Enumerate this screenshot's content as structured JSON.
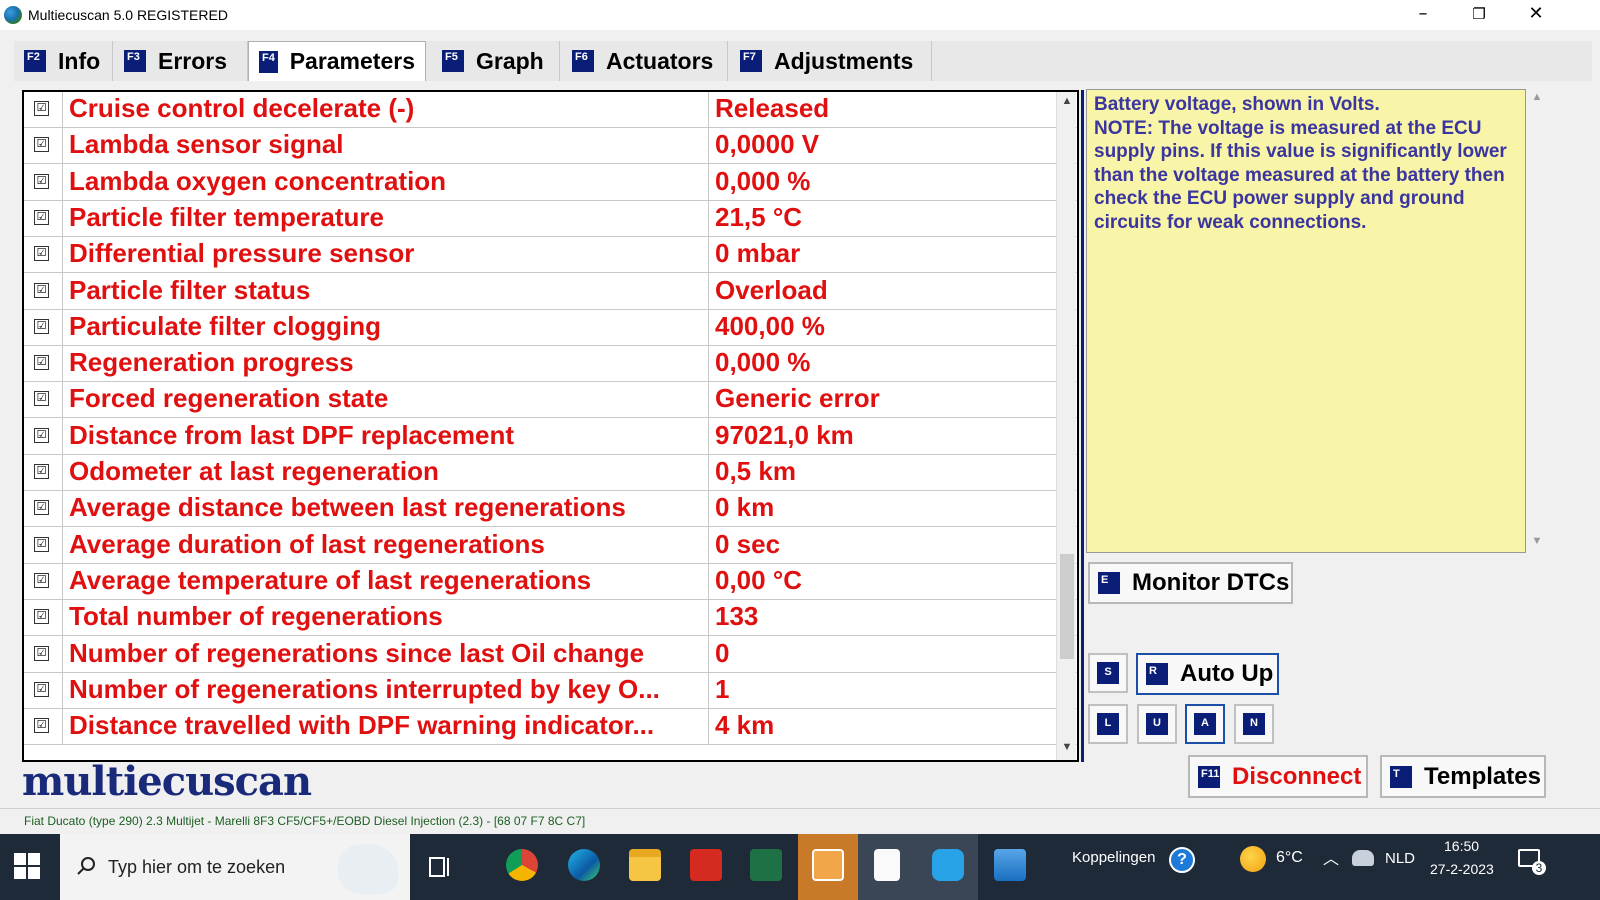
{
  "window": {
    "title": "Multiecuscan 5.0 REGISTERED",
    "minimize": "–",
    "maximize": "❐",
    "close": "✕"
  },
  "tabs": [
    {
      "key": "F2",
      "label": "Info"
    },
    {
      "key": "F3",
      "label": "Errors"
    },
    {
      "key": "F4",
      "label": "Parameters",
      "active": true
    },
    {
      "key": "F5",
      "label": "Graph"
    },
    {
      "key": "F6",
      "label": "Actuators"
    },
    {
      "key": "F7",
      "label": "Adjustments"
    }
  ],
  "parameters": [
    {
      "name": "Cruise control decelerate (-)",
      "value": "Released"
    },
    {
      "name": "Lambda sensor signal",
      "value": "0,0000 V"
    },
    {
      "name": "Lambda oxygen concentration",
      "value": "0,000 %"
    },
    {
      "name": "Particle filter temperature",
      "value": "21,5 °C"
    },
    {
      "name": "Differential pressure sensor",
      "value": "0 mbar"
    },
    {
      "name": "Particle filter status",
      "value": "Overload"
    },
    {
      "name": "Particulate filter clogging",
      "value": "400,00 %"
    },
    {
      "name": "Regeneration progress",
      "value": "0,000 %"
    },
    {
      "name": "Forced regeneration state",
      "value": "Generic error"
    },
    {
      "name": "Distance from last DPF replacement",
      "value": "97021,0 km"
    },
    {
      "name": "Odometer at last regeneration",
      "value": "0,5 km"
    },
    {
      "name": "Average distance between last regenerations",
      "value": "0 km"
    },
    {
      "name": "Average duration of last regenerations",
      "value": "0 sec"
    },
    {
      "name": "Average temperature of last regenerations",
      "value": "0,00 °C"
    },
    {
      "name": "Total number of regenerations",
      "value": "133"
    },
    {
      "name": "Number of regenerations since last Oil change",
      "value": "0"
    },
    {
      "name": "Number of regenerations interrupted by key O...",
      "value": "1"
    },
    {
      "name": "Distance travelled with DPF warning indicator...",
      "value": "4 km"
    }
  ],
  "checkbox_mark": "☑",
  "scroll": {
    "up": "▲",
    "down": "▼"
  },
  "info": {
    "line1": "Battery voltage, shown in Volts.",
    "note": "NOTE: The voltage is measured at the ECU supply pins. If this value is significantly lower than the voltage measured at the battery then check the ECU power supply and ground circuits for weak connections."
  },
  "buttons": {
    "monitor_dtcs": {
      "key": "E",
      "label": "Monitor DTCs"
    },
    "s": {
      "key": "S"
    },
    "auto_up": {
      "key": "R",
      "label": "Auto Up"
    },
    "l": {
      "key": "L"
    },
    "u": {
      "key": "U"
    },
    "a": {
      "key": "A"
    },
    "n": {
      "key": "N"
    },
    "disconnect": {
      "key": "F11",
      "label": "Disconnect"
    },
    "templates": {
      "key": "T",
      "label": "Templates"
    }
  },
  "logo": "multiecuscan",
  "status": "Fiat Ducato (type 290) 2.3 Multijet - Marelli 8F3 CF5/CF5+/EOBD Diesel Injection (2.3) - [68 07 F7 8C C7]",
  "taskbar": {
    "search_placeholder": "Typ hier om te zoeken",
    "links_label": "Koppelingen",
    "help_glyph": "?",
    "temperature": "6°C",
    "language": "NLD",
    "time": "16:50",
    "date": "27-2-2023",
    "notifications": "3"
  },
  "colors": {
    "accent": "#0a1e78",
    "value_red": "#e01010",
    "info_bg": "#f8f4a8",
    "info_text": "#3a35a0"
  }
}
